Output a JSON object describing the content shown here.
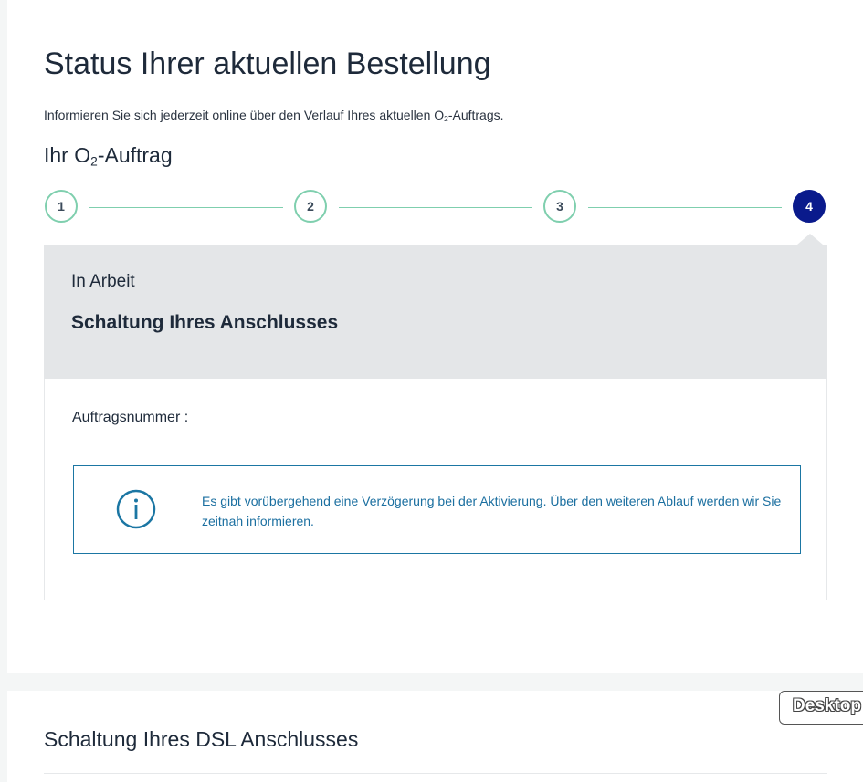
{
  "header": {
    "title": "Status Ihrer aktuellen Bestellung",
    "intro_before": "Informieren Sie sich jederzeit online über den Verlauf Ihres aktuellen O",
    "intro_sub": "2",
    "intro_after": "-Auftrags."
  },
  "order_heading": {
    "before": "Ihr O",
    "sub": "2",
    "after": "-Auftrag"
  },
  "stepper": {
    "steps": [
      "1",
      "2",
      "3",
      "4"
    ],
    "active_step": 4,
    "colors": {
      "inactive_border": "#7fcfae",
      "active_fill": "#0a1a8c"
    }
  },
  "status": {
    "label": "In Arbeit",
    "title": "Schaltung Ihres Anschlusses"
  },
  "details": {
    "order_number_label": "Auftragsnummer :",
    "info_message": "Es gibt vorübergehend eine Verzögerung bei der Aktivierung. Über den weiteren Ablauf werden wir Sie zeitnah informieren.",
    "info_icon": "info-circle-icon",
    "info_color": "#1b76a3"
  },
  "lower_section": {
    "title": "Schaltung Ihres DSL Anschlusses"
  },
  "badge": {
    "label": "Desktop"
  }
}
